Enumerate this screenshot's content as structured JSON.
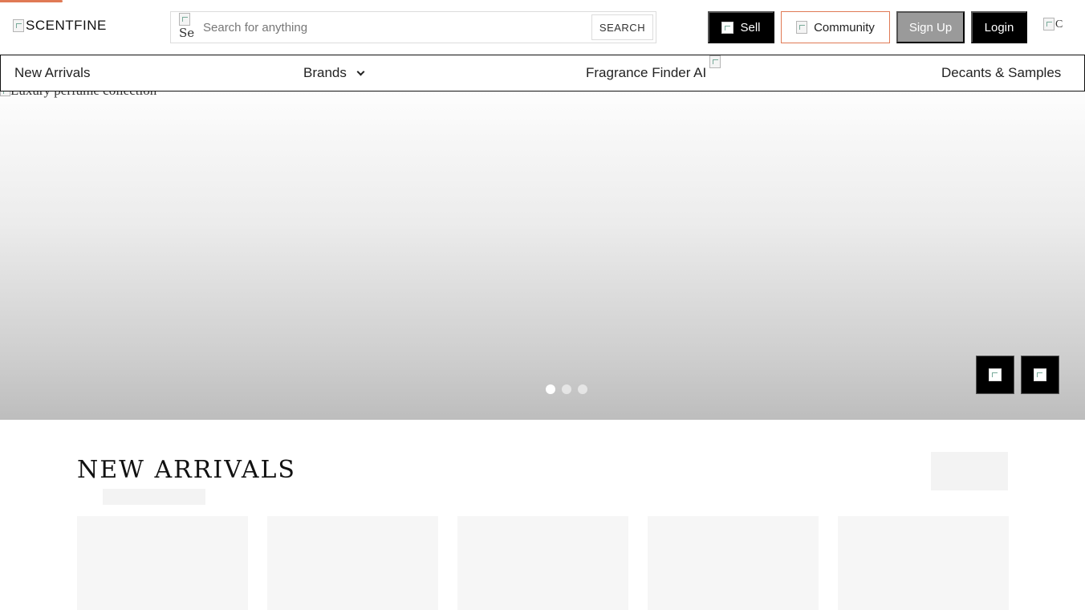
{
  "header": {
    "logo_text": "SCENTFINE",
    "search": {
      "icon_alt": "Se",
      "placeholder": "Search for anything",
      "button_label": "SEARCH"
    },
    "buttons": {
      "sell": "Sell",
      "community": "Community",
      "signup": "Sign Up",
      "login": "Login"
    },
    "cart_icon_alt": "C"
  },
  "nav": {
    "items": [
      {
        "label": "New Arrivals"
      },
      {
        "label": "Brands"
      },
      {
        "label": "Fragrance Finder AI"
      },
      {
        "label": "Decants & Samples"
      }
    ]
  },
  "hero": {
    "image_alt": "Luxury perfume collection",
    "slides_total": 3,
    "active_slide": 1
  },
  "new_arrivals": {
    "title": "NEW ARRIVALS",
    "product_card_count": 5
  },
  "colors": {
    "accent": "#e07a55",
    "primary_button": "#000000",
    "signup_button": "#9a9a9a",
    "skeleton": "#f5f5f5"
  }
}
